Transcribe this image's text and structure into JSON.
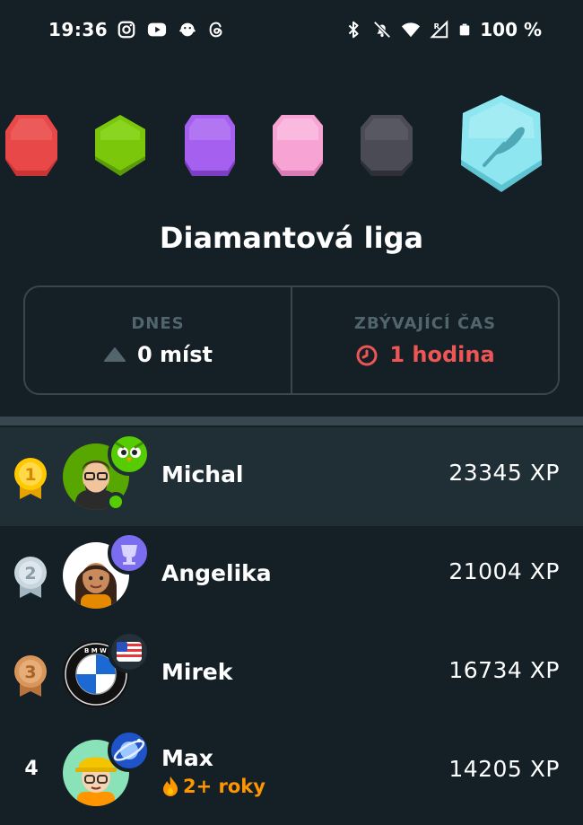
{
  "status_bar": {
    "time": "19:36",
    "battery": "100 %",
    "left_icons": [
      "instagram-icon",
      "youtube-icon",
      "bird-app-icon",
      "threads-icon"
    ],
    "right_icons": [
      "bluetooth-icon",
      "mute-icon",
      "wifi-icon",
      "signal-icon",
      "battery-icon"
    ]
  },
  "leagues": [
    {
      "name": "red-league",
      "color": "#e84848"
    },
    {
      "name": "green-league",
      "color": "#7ac70c"
    },
    {
      "name": "purple-league",
      "color": "#a560f0"
    },
    {
      "name": "pink-league",
      "color": "#f7a3d4"
    },
    {
      "name": "dark-league",
      "color": "#4b4b55"
    },
    {
      "name": "diamond-league",
      "color": "#8ee6f0",
      "current": true
    }
  ],
  "league_title": "Diamantová liga",
  "stats": {
    "today_label": "DNES",
    "today_value": "0 míst",
    "remaining_label": "ZBÝVAJÍCÍ ČAS",
    "remaining_value": "1 hodina"
  },
  "leaderboard": [
    {
      "rank": "1",
      "name": "Michal",
      "xp": "23345 XP",
      "medal": "gold",
      "flair": "owl-icon",
      "highlighted": true,
      "online": true
    },
    {
      "rank": "2",
      "name": "Angelika",
      "xp": "21004 XP",
      "medal": "silver",
      "flair": "trophy-icon"
    },
    {
      "rank": "3",
      "name": "Mirek",
      "xp": "16734 XP",
      "medal": "bronze",
      "flair": "us-flag-icon"
    },
    {
      "rank": "4",
      "name": "Max",
      "xp": "14205 XP",
      "flair": "planet-icon",
      "streak": "2+ roky"
    }
  ],
  "colors": {
    "background": "#141f26",
    "highlight_row": "#202f36",
    "border": "#37464f",
    "muted_label": "#52656d",
    "red": "#ee5555",
    "streak_orange": "#ff9600",
    "online_green": "#58cc02"
  }
}
